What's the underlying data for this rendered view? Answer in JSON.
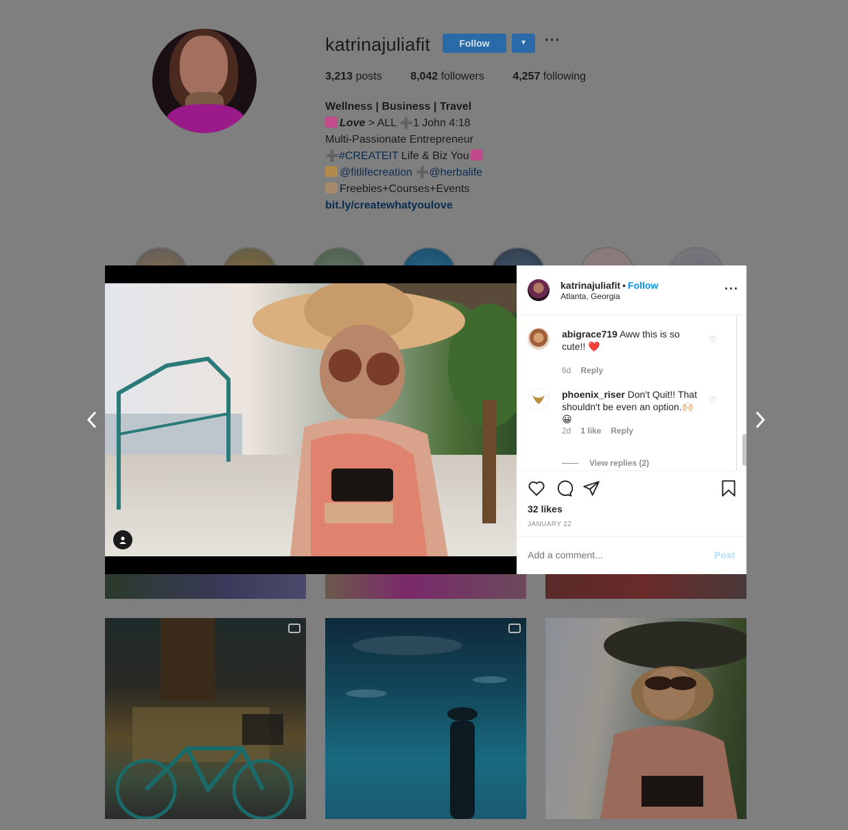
{
  "profile": {
    "username": "katrinajuliafit",
    "follow_label": "Follow",
    "more_label": "···",
    "stats": {
      "posts_count": "3,213",
      "posts_label": "posts",
      "followers_count": "8,042",
      "followers_label": "followers",
      "following_count": "4,257",
      "following_label": "following"
    },
    "bio": {
      "title": "Wellness | Business | Travel",
      "line2_love": "Love",
      "line2_rest": " > ALL ➕1 John 4:18",
      "line3": "Multi-Passionate Entrepreneur",
      "line4_plus": "➕",
      "line4_tag": "#CREATEIT",
      "line4_rest": " Life & Biz You",
      "line5_tag1": "@fitlifecreation",
      "line5_plus": " ➕",
      "line5_tag2": "@herbalife",
      "line6": "Freebies+Courses+Events",
      "link": "bit.ly/createwhatyoulove"
    }
  },
  "post": {
    "username": "katrinajuliafit",
    "dot": "•",
    "follow_label": "Follow",
    "location": "Atlanta, Georgia",
    "more_label": "···",
    "comments": [
      {
        "username": "abigrace719",
        "text": "Aww this is so cute!! ❤️",
        "age": "6d",
        "reply_label": "Reply"
      },
      {
        "username": "phoenix_riser",
        "text": "Don't Quit!! That shouldn't be even an option.🙌🏻😀",
        "age": "2d",
        "likes": "1 like",
        "reply_label": "Reply"
      }
    ],
    "view_replies": "View replies (2)",
    "likes": "32 likes",
    "date": "JANUARY 22",
    "add_comment_placeholder": "Add a comment...",
    "post_label": "Post"
  },
  "colors": {
    "accent_blue": "#0095f6",
    "follow_button_dimmed": "#2a6aa8",
    "overlay_background": "#7f7f7f",
    "heart_red": "#ed1c3a"
  },
  "icons": [
    "heart-icon",
    "comment-icon",
    "share-icon",
    "bookmark-icon",
    "chevron-left-icon",
    "chevron-right-icon",
    "user-tag-icon",
    "video-icon",
    "carousel-icon"
  ]
}
